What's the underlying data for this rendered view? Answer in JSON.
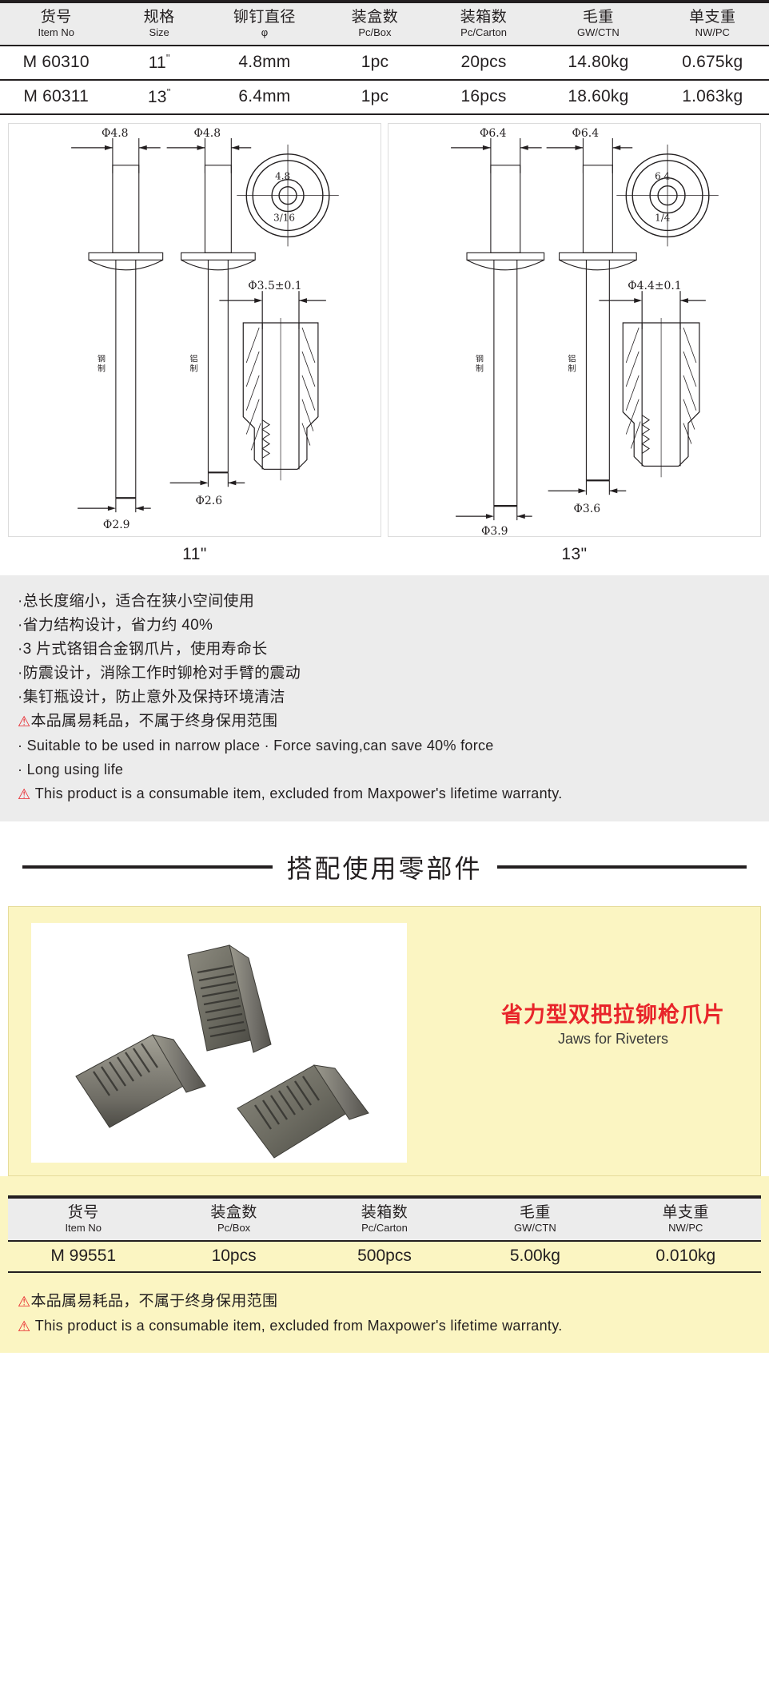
{
  "spec_table": {
    "columns": [
      {
        "cn": "货号",
        "en": "Item No"
      },
      {
        "cn": "规格",
        "en": "Size"
      },
      {
        "cn": "铆钉直径",
        "en": "φ"
      },
      {
        "cn": "装盒数",
        "en": "Pc/Box"
      },
      {
        "cn": "装箱数",
        "en": "Pc/Carton"
      },
      {
        "cn": "毛重",
        "en": "GW/CTN"
      },
      {
        "cn": "单支重",
        "en": "NW/PC"
      }
    ],
    "rows": [
      {
        "item_no": "M 60310",
        "size_num": "11",
        "size_unit": "\"",
        "rivet_dia": "4.8mm",
        "pc_box": "1pc",
        "pc_carton": "20pcs",
        "gw_ctn": "14.80kg",
        "nw_pc": "0.675kg"
      },
      {
        "item_no": "M 60311",
        "size_num": "13",
        "size_unit": "\"",
        "rivet_dia": "6.4mm",
        "pc_box": "1pc",
        "pc_carton": "16pcs",
        "gw_ctn": "18.60kg",
        "nw_pc": "1.063kg"
      }
    ]
  },
  "drawings": {
    "left": {
      "caption": "11\"",
      "head_dia_1": "Φ4.8",
      "head_dia_2": "Φ4.8",
      "stem_dia_1": "Φ2.9",
      "stem_dia_2": "Φ2.6",
      "circle_top": "4.8",
      "circle_bottom": "3/16",
      "nose_dia": "Φ3.5±0.1",
      "material_1": "钢制",
      "material_2": "铝制"
    },
    "right": {
      "caption": "13\"",
      "head_dia_1": "Φ6.4",
      "head_dia_2": "Φ6.4",
      "stem_dia_1": "Φ3.9",
      "stem_dia_2": "Φ3.6",
      "circle_top": "6.4",
      "circle_bottom": "1/4",
      "nose_dia": "Φ4.4±0.1",
      "material_1": "钢制",
      "material_2": "铝制"
    }
  },
  "features": {
    "bullets_cn": [
      "·总长度缩小，适合在狭小空间使用",
      "·省力结构设计，省力约 40%",
      "·3 片式铬钼合金钢爪片，使用寿命长",
      "·防震设计，消除工作时铆枪对手臂的震动",
      "·集钉瓶设计，防止意外及保持环境清洁"
    ],
    "warning_cn": "本品属易耗品，不属于终身保用范围",
    "bullets_en": [
      "· Suitable to be used in narrow place · Force saving,can save 40% force",
      "· Long using life"
    ],
    "warning_en": "This product is a consumable item, excluded from Maxpower's lifetime warranty.",
    "warning_symbol": "⚠"
  },
  "section": {
    "title": "搭配使用零部件"
  },
  "jaws": {
    "title_cn": "省力型双把拉铆枪爪片",
    "title_en": "Jaws for Riveters",
    "table": {
      "columns": [
        {
          "cn": "货号",
          "en": "Item No"
        },
        {
          "cn": "装盒数",
          "en": "Pc/Box"
        },
        {
          "cn": "装箱数",
          "en": "Pc/Carton"
        },
        {
          "cn": "毛重",
          "en": "GW/CTN"
        },
        {
          "cn": "单支重",
          "en": "NW/PC"
        }
      ],
      "rows": [
        {
          "item_no": "M 99551",
          "pc_box": "10pcs",
          "pc_carton": "500pcs",
          "gw_ctn": "5.00kg",
          "nw_pc": "0.010kg"
        }
      ]
    },
    "warning_cn": "本品属易耗品，不属于终身保用范围",
    "warning_en": "This product is a consumable item, excluded from Maxpower's lifetime warranty.",
    "warning_symbol": "⚠"
  },
  "colors": {
    "ink": "#231f20",
    "header_grey": "#ececec",
    "panel_yellow": "#fbf5c2",
    "warning_red": "#e8242a"
  }
}
